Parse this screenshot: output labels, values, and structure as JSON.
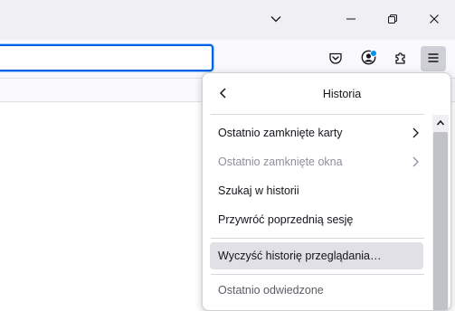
{
  "window": {
    "controls": [
      "chevron-down-icon",
      "minimize-icon",
      "restore-icon",
      "close-icon"
    ]
  },
  "toolbar": {
    "icons": [
      "pocket-icon",
      "account-icon",
      "extensions-icon",
      "menu-icon"
    ],
    "account_badge_color": "#0090ed",
    "urlbar_focus_color": "#0061e0"
  },
  "history_panel": {
    "title": "Historia",
    "items": [
      {
        "label": "Ostatnio zamknięte karty",
        "enabled": true,
        "submenu": true
      },
      {
        "label": "Ostatnio zamknięte okna",
        "enabled": false,
        "submenu": true
      },
      {
        "label": "Szukaj w historii",
        "enabled": true,
        "submenu": false
      },
      {
        "label": "Przywróć poprzednią sesję",
        "enabled": true,
        "submenu": false
      },
      {
        "label": "Wyczyść historię przeglądania…",
        "enabled": true,
        "submenu": false,
        "hovered": true
      },
      {
        "label": "Ostatnio odwiedzone",
        "enabled": false,
        "submenu": false
      }
    ]
  }
}
